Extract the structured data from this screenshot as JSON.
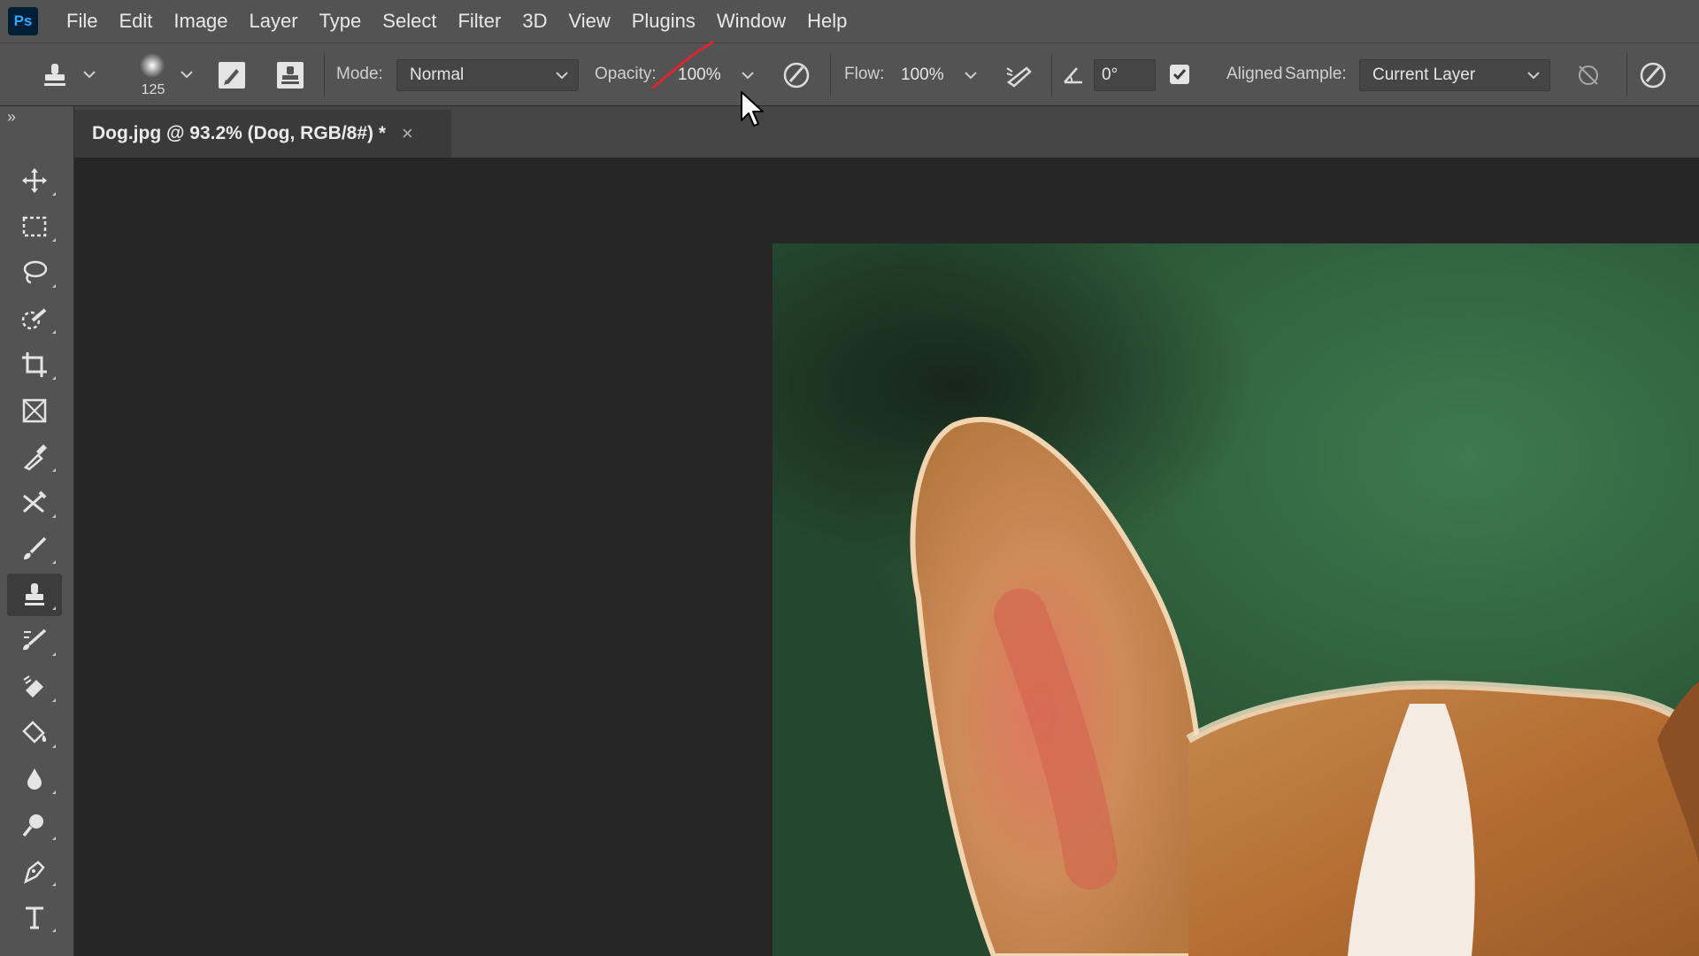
{
  "app": {
    "logo": "Ps",
    "menu": [
      "File",
      "Edit",
      "Image",
      "Layer",
      "Type",
      "Select",
      "Filter",
      "3D",
      "View",
      "Plugins",
      "Window",
      "Help"
    ]
  },
  "options": {
    "brush_size": "125",
    "mode_label": "Mode:",
    "mode_value": "Normal",
    "opacity_label": "Opacity:",
    "opacity_value": "100%",
    "flow_label": "Flow:",
    "flow_value": "100%",
    "angle_value": "0°",
    "aligned_label": "Aligned",
    "aligned_checked": true,
    "sample_label": "Sample:",
    "sample_value": "Current Layer"
  },
  "document": {
    "tab_title": "Dog.jpg @ 93.2% (Dog, RGB/8#) *",
    "close": "×"
  },
  "toolbar": {
    "collapse": "»",
    "active_tool": "clone-stamp",
    "tools": [
      "move",
      "rectangular-marquee",
      "lasso",
      "quick-selection",
      "crop",
      "frame",
      "eyedropper",
      "spot-healing",
      "brush",
      "clone-stamp",
      "history-brush",
      "eraser",
      "paint-bucket",
      "blur",
      "dodge",
      "pen",
      "type"
    ]
  },
  "colors": {
    "panel": "#535353",
    "workspace": "#262626",
    "accent_ps": "#31a8ff"
  }
}
